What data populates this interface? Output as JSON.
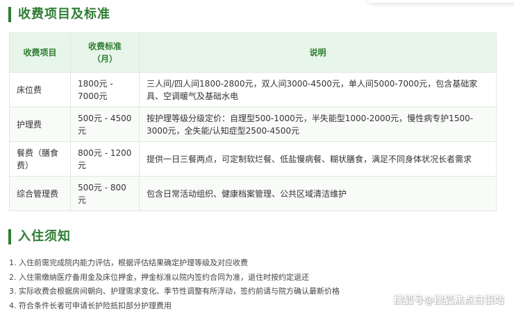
{
  "colors": {
    "accent": "#2e7d32",
    "header_bg": "#e8f5e9",
    "border": "#dfe8df"
  },
  "fee_section": {
    "title": "收费项目及标准"
  },
  "fee_table": {
    "headers": [
      "收费项目",
      "收费标准\n（月）",
      "说明"
    ],
    "rows": [
      [
        "床位费",
        "1800元 - 7000元",
        "三人间/四人间1800-2800元，双人间3000-4500元，单人间5000-7000元，包含基础家具、空调暖气及基础水电"
      ],
      [
        "护理费",
        "500元 - 4500元",
        "按护理等级分级定价：自理型500-1000元，半失能型1000-2000元，慢性病专护1500-3000元，全失能/认知症型2500-4500元"
      ],
      [
        "餐费（膳食费）",
        "800元 - 1200元",
        "提供一日三餐两点，可定制软烂餐、低盐慢病餐、糊状膳食，满足不同身体状况长者需求"
      ],
      [
        "综合管理费",
        "500元 - 800元",
        "包含日常活动组织、健康档案管理、公共区域清洁维护"
      ]
    ]
  },
  "notice_section": {
    "title": "入住须知",
    "items": [
      "1. 入住前需完成院内能力评估，根据评估结果确定护理等级及对应收费",
      "2. 入住需缴纳医疗备用金及床位押金，押金标准以院内签约合同为准，退住时按约定退还",
      "3. 实际收费会根据房间朝向、护理需求变化、季节性调整有所浮动，签约前请与院方确认最新价格",
      "4. 符合条件长者可申请长护险抵扣部分护理费用"
    ]
  },
  "watermark": "搜狐号@搜狐焦点白银站"
}
